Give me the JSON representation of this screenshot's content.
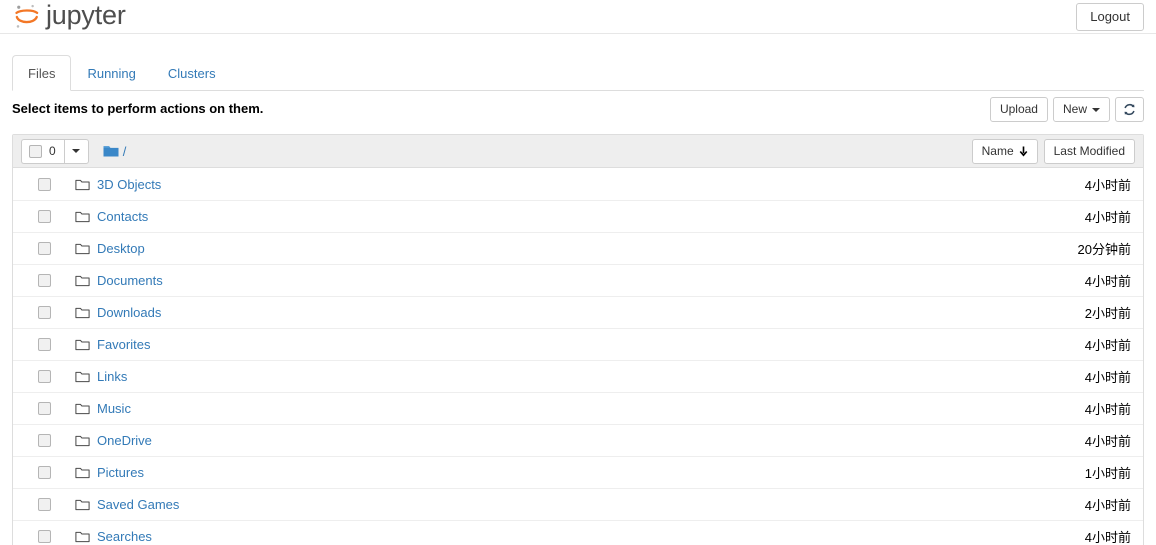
{
  "header": {
    "brand_text": "jupyter",
    "brand_logo_icon": "jupyter-planet-logo",
    "logout_label": "Logout",
    "brand_color": "#f37726"
  },
  "tabs": [
    {
      "label": "Files",
      "active": true
    },
    {
      "label": "Running",
      "active": false
    },
    {
      "label": "Clusters",
      "active": false
    }
  ],
  "toolbar": {
    "select_message": "Select items to perform actions on them.",
    "upload_label": "Upload",
    "new_label": "New",
    "refresh_icon": "refresh-icon",
    "link_color": "#337ab7"
  },
  "list_header": {
    "selected_count": "0",
    "checkbox_icon": "checkbox-unchecked-icon",
    "dropdown_caret_icon": "chevron-down-icon",
    "folder_icon": "folder-filled-icon",
    "breadcrumb_path": "/",
    "sort_name_label": "Name",
    "sort_name_arrow": "arrow-down-icon",
    "sort_modified_label": "Last Modified"
  },
  "items": [
    {
      "name": "3D Objects",
      "icon": "folder-outline-icon",
      "modified": "4小时前"
    },
    {
      "name": "Contacts",
      "icon": "folder-outline-icon",
      "modified": "4小时前"
    },
    {
      "name": "Desktop",
      "icon": "folder-outline-icon",
      "modified": "20分钟前"
    },
    {
      "name": "Documents",
      "icon": "folder-outline-icon",
      "modified": "4小时前"
    },
    {
      "name": "Downloads",
      "icon": "folder-outline-icon",
      "modified": "2小时前"
    },
    {
      "name": "Favorites",
      "icon": "folder-outline-icon",
      "modified": "4小时前"
    },
    {
      "name": "Links",
      "icon": "folder-outline-icon",
      "modified": "4小时前"
    },
    {
      "name": "Music",
      "icon": "folder-outline-icon",
      "modified": "4小时前"
    },
    {
      "name": "OneDrive",
      "icon": "folder-outline-icon",
      "modified": "4小时前"
    },
    {
      "name": "Pictures",
      "icon": "folder-outline-icon",
      "modified": "1小时前"
    },
    {
      "name": "Saved Games",
      "icon": "folder-outline-icon",
      "modified": "4小时前"
    },
    {
      "name": "Searches",
      "icon": "folder-outline-icon",
      "modified": "4小时前"
    }
  ]
}
